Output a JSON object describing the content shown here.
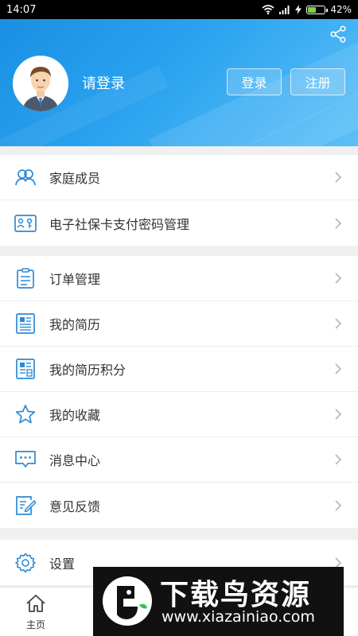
{
  "status_bar": {
    "time": "14:07",
    "battery": "42%"
  },
  "header": {
    "login_prompt": "请登录",
    "login_button": "登录",
    "register_button": "注册"
  },
  "menu_group1": [
    {
      "label": "家庭成员",
      "icon": "family-icon"
    },
    {
      "label": "电子社保卡支付密码管理",
      "icon": "card-key-icon"
    }
  ],
  "menu_group2": [
    {
      "label": "订单管理",
      "icon": "clipboard-icon"
    },
    {
      "label": "我的简历",
      "icon": "resume-icon"
    },
    {
      "label": "我的简历积分",
      "icon": "resume-points-icon"
    },
    {
      "label": "我的收藏",
      "icon": "star-icon"
    },
    {
      "label": "消息中心",
      "icon": "message-icon"
    },
    {
      "label": "意见反馈",
      "icon": "feedback-icon"
    }
  ],
  "menu_group3": [
    {
      "label": "设置",
      "icon": "gear-icon"
    }
  ],
  "bottom_nav": {
    "home_label": "主页"
  },
  "watermark": {
    "title": "下载鸟资源",
    "url": "www.xiazainiao.com"
  },
  "colors": {
    "accent": "#1a8fe3",
    "icon_blue": "#2b8ad8"
  }
}
